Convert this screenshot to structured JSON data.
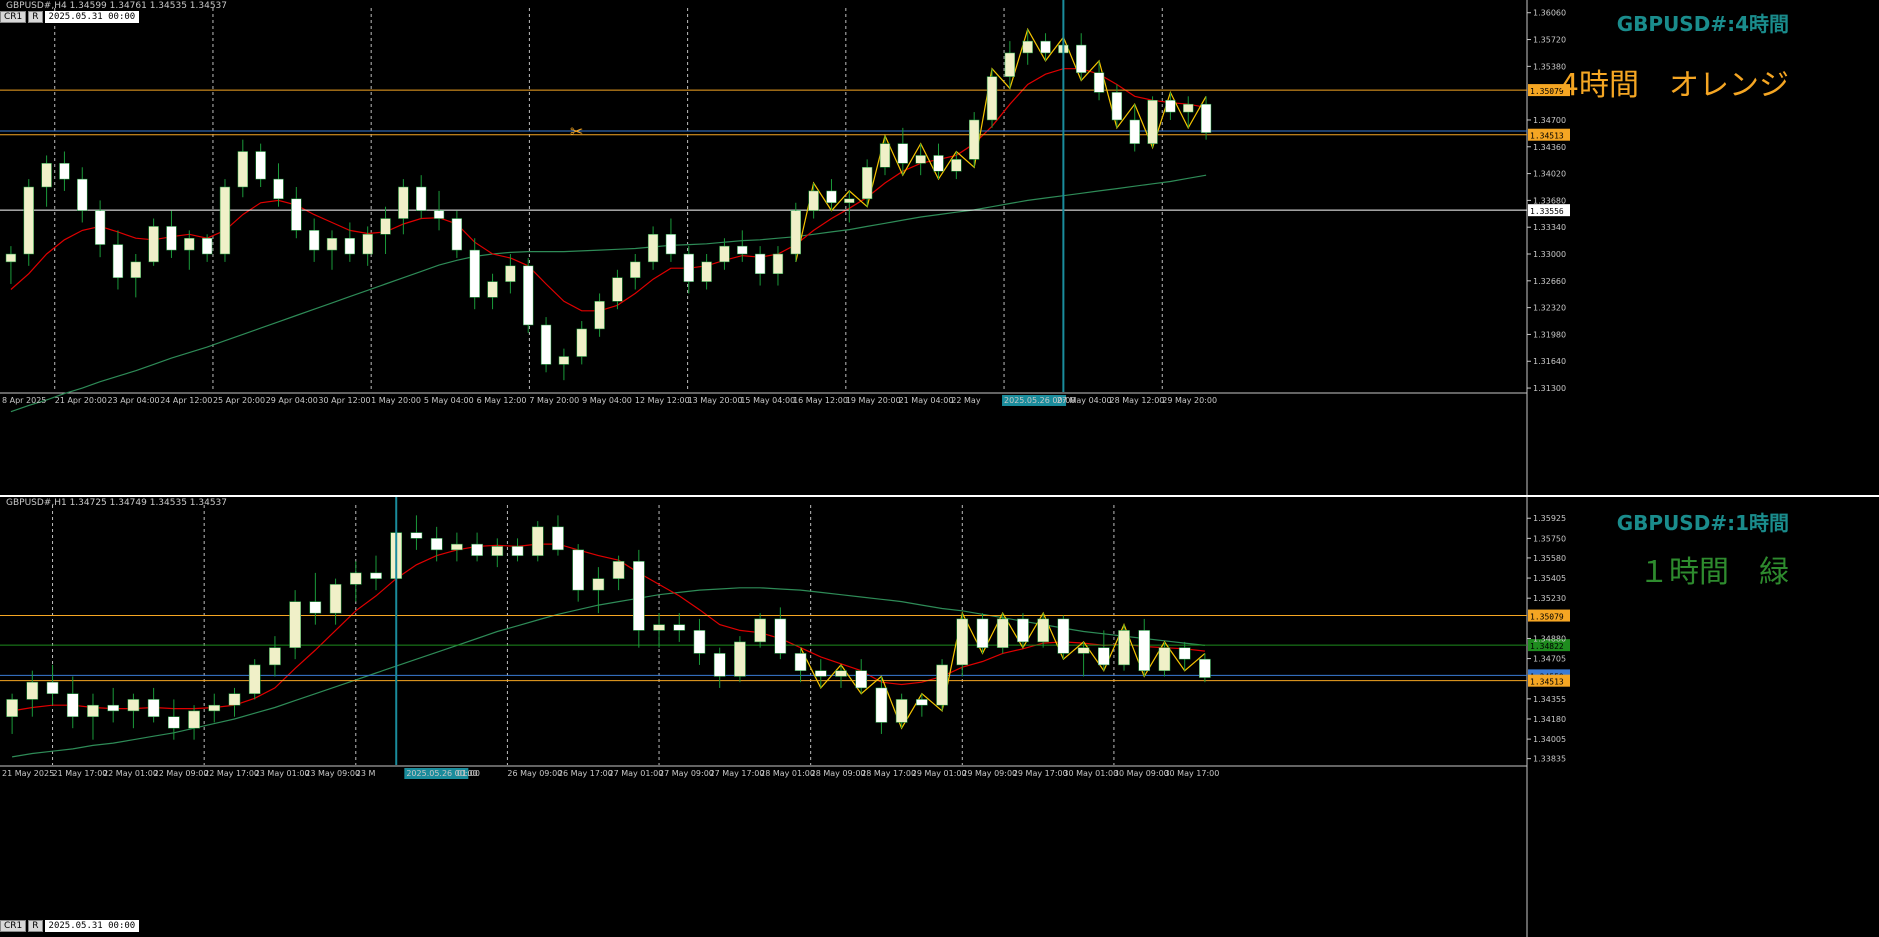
{
  "top": {
    "info": "GBPUSD#,H4 1.34599 1.34761 1.34535 1.34537",
    "buttons": [
      "CR1",
      "R"
    ],
    "datetime": "2025.05.31 00:00",
    "symbol_label": "GBPUSD#:4時間",
    "tag_label": "4時間　オレンジ",
    "tag_color": "#f5a623",
    "marker": "✂",
    "cursor_label": "2025.05.26 00:00"
  },
  "bottom": {
    "info": "GBPUSD#,H1 1.34725 1.34749 1.34535 1.34537",
    "buttons": [
      "CR1",
      "R"
    ],
    "datetime": "2025.05.31 00:00",
    "symbol_label": "GBPUSD#:1時間",
    "tag_label": "１時間　緑",
    "tag_color": "#2e8b2e",
    "cursor_label": "2025.05.26 00:00"
  },
  "colors": {
    "bull": "#f0f0c8",
    "bear": "#ffffff",
    "wick": "#1a9a3a",
    "ma_fast": "#e00000",
    "ma_slow": "#2e8b57",
    "zigzag": "#f5c400",
    "hline_orange": "#f5a623",
    "hline_blue": "#3a7bd5",
    "hline_white": "#ffffff",
    "hline_green": "#1e8c1e",
    "cursor": "#1a8c9c"
  },
  "chart_data": [
    {
      "type": "candlestick",
      "title": "GBPUSD#,H4",
      "x_ticks": [
        "8 Apr 2025",
        "21 Apr 20:00",
        "23 Apr 04:00",
        "24 Apr 12:00",
        "25 Apr 20:00",
        "29 Apr 04:00",
        "30 Apr 12:00",
        "1 May 20:00",
        "5 May 04:00",
        "6 May 12:00",
        "7 May 20:00",
        "9 May 04:00",
        "12 May 12:00",
        "13 May 20:00",
        "15 May 04:00",
        "16 May 12:00",
        "19 May 20:00",
        "21 May 04:00",
        "22 May",
        "2025.05.26 00:00",
        "27 May 04:00",
        "28 May 12:00",
        "29 May 20:00"
      ],
      "y_ticks": [
        "1.36060",
        "1.35720",
        "1.35380",
        "1.34700",
        "1.34360",
        "1.34020",
        "1.33680",
        "1.33340",
        "1.33000",
        "1.32660",
        "1.32320",
        "1.31980",
        "1.31640",
        "1.31300"
      ],
      "ylim": [
        1.3125,
        1.3612
      ],
      "price_labels": [
        "1.35079",
        "1.34513",
        "1.33556"
      ],
      "current_price": 1.34537,
      "ohlc": [
        [
          1.329,
          1.331,
          1.3262,
          1.33
        ],
        [
          1.33,
          1.3395,
          1.3285,
          1.3385
        ],
        [
          1.3385,
          1.3425,
          1.336,
          1.3415
        ],
        [
          1.3415,
          1.343,
          1.338,
          1.3395
        ],
        [
          1.3395,
          1.341,
          1.334,
          1.3355
        ],
        [
          1.3355,
          1.3368,
          1.3296,
          1.3312
        ],
        [
          1.3312,
          1.333,
          1.3255,
          1.327
        ],
        [
          1.327,
          1.33,
          1.3245,
          1.329
        ],
        [
          1.329,
          1.3345,
          1.3285,
          1.3335
        ],
        [
          1.3335,
          1.3355,
          1.3295,
          1.3305
        ],
        [
          1.3305,
          1.333,
          1.328,
          1.332
        ],
        [
          1.332,
          1.3325,
          1.329,
          1.33
        ],
        [
          1.33,
          1.3395,
          1.329,
          1.3385
        ],
        [
          1.3385,
          1.3445,
          1.3372,
          1.343
        ],
        [
          1.343,
          1.344,
          1.3385,
          1.3395
        ],
        [
          1.3395,
          1.3415,
          1.336,
          1.337
        ],
        [
          1.337,
          1.3385,
          1.332,
          1.333
        ],
        [
          1.333,
          1.3345,
          1.329,
          1.3305
        ],
        [
          1.3305,
          1.333,
          1.328,
          1.332
        ],
        [
          1.332,
          1.334,
          1.329,
          1.33
        ],
        [
          1.33,
          1.3335,
          1.3285,
          1.3325
        ],
        [
          1.3325,
          1.336,
          1.33,
          1.3345
        ],
        [
          1.3345,
          1.3395,
          1.3325,
          1.3385
        ],
        [
          1.3385,
          1.34,
          1.3345,
          1.3355
        ],
        [
          1.3355,
          1.338,
          1.333,
          1.3345
        ],
        [
          1.3345,
          1.3355,
          1.3295,
          1.3305
        ],
        [
          1.3305,
          1.332,
          1.323,
          1.3245
        ],
        [
          1.3245,
          1.3275,
          1.323,
          1.3265
        ],
        [
          1.3265,
          1.33,
          1.325,
          1.3285
        ],
        [
          1.3285,
          1.3295,
          1.32,
          1.321
        ],
        [
          1.321,
          1.322,
          1.315,
          1.316
        ],
        [
          1.316,
          1.318,
          1.314,
          1.317
        ],
        [
          1.317,
          1.3215,
          1.316,
          1.3205
        ],
        [
          1.3205,
          1.325,
          1.3195,
          1.324
        ],
        [
          1.324,
          1.328,
          1.323,
          1.327
        ],
        [
          1.327,
          1.33,
          1.3255,
          1.329
        ],
        [
          1.329,
          1.3335,
          1.328,
          1.3325
        ],
        [
          1.3325,
          1.3345,
          1.329,
          1.33
        ],
        [
          1.33,
          1.331,
          1.325,
          1.3265
        ],
        [
          1.3265,
          1.33,
          1.3255,
          1.329
        ],
        [
          1.329,
          1.332,
          1.328,
          1.331
        ],
        [
          1.331,
          1.333,
          1.329,
          1.33
        ],
        [
          1.33,
          1.331,
          1.326,
          1.3275
        ],
        [
          1.3275,
          1.331,
          1.326,
          1.33
        ],
        [
          1.33,
          1.3365,
          1.329,
          1.3355
        ],
        [
          1.3355,
          1.339,
          1.3345,
          1.338
        ],
        [
          1.338,
          1.3395,
          1.3355,
          1.3365
        ],
        [
          1.3365,
          1.338,
          1.334,
          1.337
        ],
        [
          1.337,
          1.342,
          1.336,
          1.341
        ],
        [
          1.341,
          1.345,
          1.34,
          1.344
        ],
        [
          1.344,
          1.346,
          1.34,
          1.3415
        ],
        [
          1.3415,
          1.344,
          1.34,
          1.3425
        ],
        [
          1.3425,
          1.344,
          1.3395,
          1.3405
        ],
        [
          1.3405,
          1.343,
          1.3395,
          1.342
        ],
        [
          1.342,
          1.348,
          1.341,
          1.347
        ],
        [
          1.347,
          1.3535,
          1.346,
          1.3525
        ],
        [
          1.3525,
          1.357,
          1.351,
          1.3555
        ],
        [
          1.3555,
          1.3585,
          1.354,
          1.357
        ],
        [
          1.357,
          1.358,
          1.3545,
          1.3555
        ],
        [
          1.3555,
          1.3575,
          1.354,
          1.3565
        ],
        [
          1.3565,
          1.358,
          1.352,
          1.353
        ],
        [
          1.353,
          1.3545,
          1.3495,
          1.3505
        ],
        [
          1.3505,
          1.3515,
          1.346,
          1.347
        ],
        [
          1.347,
          1.349,
          1.343,
          1.344
        ],
        [
          1.344,
          1.35,
          1.3435,
          1.3495
        ],
        [
          1.3495,
          1.3505,
          1.347,
          1.348
        ],
        [
          1.348,
          1.35,
          1.346,
          1.349
        ],
        [
          1.349,
          1.35,
          1.3445,
          1.3454
        ]
      ],
      "ma_fast": [
        1.3255,
        1.3275,
        1.33,
        1.3318,
        1.333,
        1.3335,
        1.3328,
        1.332,
        1.3318,
        1.3322,
        1.3325,
        1.332,
        1.333,
        1.335,
        1.3365,
        1.3368,
        1.3362,
        1.335,
        1.334,
        1.333,
        1.3326,
        1.3328,
        1.3338,
        1.3345,
        1.3346,
        1.3338,
        1.3315,
        1.33,
        1.3295,
        1.3285,
        1.3262,
        1.324,
        1.3228,
        1.3228,
        1.3235,
        1.325,
        1.3268,
        1.3282,
        1.3282,
        1.3285,
        1.3292,
        1.3298,
        1.3296,
        1.33,
        1.3312,
        1.333,
        1.3345,
        1.3358,
        1.3372,
        1.339,
        1.3405,
        1.3415,
        1.342,
        1.3425,
        1.344,
        1.3462,
        1.349,
        1.3515,
        1.3528,
        1.3535,
        1.3535,
        1.3528,
        1.3515,
        1.35,
        1.3495,
        1.3492,
        1.349,
        1.3486
      ],
      "ma_slow": [
        1.31,
        1.3108,
        1.3115,
        1.3123,
        1.313,
        1.3138,
        1.3145,
        1.3152,
        1.316,
        1.3168,
        1.3175,
        1.3182,
        1.319,
        1.3198,
        1.3206,
        1.3214,
        1.3222,
        1.323,
        1.3238,
        1.3246,
        1.3254,
        1.3262,
        1.327,
        1.3278,
        1.3286,
        1.3292,
        1.3297,
        1.33,
        1.3302,
        1.3303,
        1.3303,
        1.3303,
        1.3304,
        1.3305,
        1.3306,
        1.3307,
        1.3309,
        1.3311,
        1.3312,
        1.3313,
        1.3315,
        1.3317,
        1.3318,
        1.332,
        1.3322,
        1.3325,
        1.3328,
        1.3331,
        1.3335,
        1.3339,
        1.3343,
        1.3347,
        1.335,
        1.3353,
        1.3356,
        1.336,
        1.3364,
        1.3368,
        1.3371,
        1.3374,
        1.3377,
        1.338,
        1.3383,
        1.3386,
        1.3389,
        1.3392,
        1.3396,
        1.34
      ]
    },
    {
      "type": "candlestick",
      "title": "GBPUSD#,H1",
      "x_ticks": [
        "21 May 2025",
        "21 May 17:00",
        "22 May 01:00",
        "22 May 09:00",
        "22 May 17:00",
        "23 May 01:00",
        "23 May 09:00",
        "23 M",
        "2025.05.26 00:00",
        "01:00",
        "26 May 09:00",
        "26 May 17:00",
        "27 May 01:00",
        "27 May 09:00",
        "27 May 17:00",
        "28 May 01:00",
        "28 May 09:00",
        "28 May 17:00",
        "29 May 01:00",
        "29 May 09:00",
        "29 May 17:00",
        "30 May 01:00",
        "30 May 09:00",
        "30 May 17:00"
      ],
      "y_ticks": [
        "1.35925",
        "1.35750",
        "1.35580",
        "1.35405",
        "1.35230",
        "1.34880",
        "1.34705",
        "1.34355",
        "1.34180",
        "1.34005",
        "1.33835"
      ],
      "ylim": [
        1.3378,
        1.3604
      ],
      "price_labels": [
        "1.35079",
        "1.34822",
        "1.34559",
        "1.34513"
      ],
      "current_price": 1.34537,
      "ohlc": [
        [
          1.342,
          1.344,
          1.3405,
          1.3435
        ],
        [
          1.3435,
          1.346,
          1.342,
          1.345
        ],
        [
          1.345,
          1.3465,
          1.343,
          1.344
        ],
        [
          1.344,
          1.3455,
          1.341,
          1.342
        ],
        [
          1.342,
          1.344,
          1.34,
          1.343
        ],
        [
          1.343,
          1.3445,
          1.3415,
          1.3425
        ],
        [
          1.3425,
          1.344,
          1.341,
          1.3435
        ],
        [
          1.3435,
          1.3445,
          1.3415,
          1.342
        ],
        [
          1.342,
          1.3435,
          1.34,
          1.341
        ],
        [
          1.341,
          1.343,
          1.34,
          1.3425
        ],
        [
          1.3425,
          1.344,
          1.3415,
          1.343
        ],
        [
          1.343,
          1.3445,
          1.342,
          1.344
        ],
        [
          1.344,
          1.347,
          1.3435,
          1.3465
        ],
        [
          1.3465,
          1.349,
          1.3455,
          1.348
        ],
        [
          1.348,
          1.353,
          1.347,
          1.352
        ],
        [
          1.352,
          1.3545,
          1.35,
          1.351
        ],
        [
          1.351,
          1.354,
          1.35,
          1.3535
        ],
        [
          1.3535,
          1.3555,
          1.352,
          1.3545
        ],
        [
          1.3545,
          1.356,
          1.353,
          1.354
        ],
        [
          1.354,
          1.359,
          1.3535,
          1.358
        ],
        [
          1.358,
          1.3595,
          1.3565,
          1.3575
        ],
        [
          1.3575,
          1.3585,
          1.3555,
          1.3565
        ],
        [
          1.3565,
          1.358,
          1.3555,
          1.357
        ],
        [
          1.357,
          1.358,
          1.3555,
          1.356
        ],
        [
          1.356,
          1.3575,
          1.355,
          1.3568
        ],
        [
          1.3568,
          1.3575,
          1.3555,
          1.356
        ],
        [
          1.356,
          1.359,
          1.3555,
          1.3585
        ],
        [
          1.3585,
          1.3595,
          1.356,
          1.3565
        ],
        [
          1.3565,
          1.357,
          1.352,
          1.353
        ],
        [
          1.353,
          1.355,
          1.351,
          1.354
        ],
        [
          1.354,
          1.356,
          1.353,
          1.3555
        ],
        [
          1.3555,
          1.3565,
          1.348,
          1.3495
        ],
        [
          1.3495,
          1.351,
          1.348,
          1.35
        ],
        [
          1.35,
          1.351,
          1.3485,
          1.3495
        ],
        [
          1.3495,
          1.3505,
          1.3465,
          1.3475
        ],
        [
          1.3475,
          1.348,
          1.3445,
          1.3455
        ],
        [
          1.3455,
          1.349,
          1.345,
          1.3485
        ],
        [
          1.3485,
          1.351,
          1.348,
          1.3505
        ],
        [
          1.3505,
          1.3515,
          1.347,
          1.3475
        ],
        [
          1.3475,
          1.348,
          1.345,
          1.346
        ],
        [
          1.346,
          1.347,
          1.3445,
          1.3455
        ],
        [
          1.3455,
          1.3465,
          1.3445,
          1.346
        ],
        [
          1.346,
          1.347,
          1.344,
          1.3445
        ],
        [
          1.3445,
          1.3455,
          1.3405,
          1.3415
        ],
        [
          1.3415,
          1.344,
          1.341,
          1.3435
        ],
        [
          1.3435,
          1.344,
          1.342,
          1.343
        ],
        [
          1.343,
          1.347,
          1.3425,
          1.3465
        ],
        [
          1.3465,
          1.351,
          1.3455,
          1.3505
        ],
        [
          1.3505,
          1.351,
          1.3475,
          1.348
        ],
        [
          1.348,
          1.351,
          1.3475,
          1.3505
        ],
        [
          1.3505,
          1.351,
          1.348,
          1.3485
        ],
        [
          1.3485,
          1.351,
          1.348,
          1.3505
        ],
        [
          1.3505,
          1.3508,
          1.347,
          1.3475
        ],
        [
          1.3475,
          1.3485,
          1.3455,
          1.348
        ],
        [
          1.348,
          1.3495,
          1.346,
          1.3465
        ],
        [
          1.3465,
          1.35,
          1.346,
          1.3495
        ],
        [
          1.3495,
          1.3505,
          1.3455,
          1.346
        ],
        [
          1.346,
          1.3485,
          1.3455,
          1.348
        ],
        [
          1.348,
          1.3485,
          1.346,
          1.347
        ],
        [
          1.347,
          1.3475,
          1.345,
          1.3454
        ]
      ],
      "ma_fast": [
        1.3425,
        1.3428,
        1.343,
        1.343,
        1.3428,
        1.3427,
        1.3427,
        1.3428,
        1.3427,
        1.3427,
        1.3428,
        1.343,
        1.3436,
        1.3445,
        1.3462,
        1.3478,
        1.3495,
        1.3512,
        1.3525,
        1.354,
        1.3552,
        1.356,
        1.3565,
        1.3568,
        1.3569,
        1.3568,
        1.357,
        1.357,
        1.3565,
        1.356,
        1.3556,
        1.3545,
        1.3535,
        1.3525,
        1.3513,
        1.35,
        1.3495,
        1.3493,
        1.3488,
        1.348,
        1.3472,
        1.3466,
        1.346,
        1.345,
        1.3448,
        1.345,
        1.3455,
        1.3463,
        1.3468,
        1.3475,
        1.3479,
        1.3484,
        1.3485,
        1.3484,
        1.3482,
        1.3483,
        1.3481,
        1.348,
        1.3479,
        1.3477
      ],
      "ma_slow": [
        1.3385,
        1.3388,
        1.339,
        1.3392,
        1.3395,
        1.3397,
        1.34,
        1.3403,
        1.3406,
        1.341,
        1.3414,
        1.3418,
        1.3423,
        1.3428,
        1.3434,
        1.344,
        1.3446,
        1.3452,
        1.3458,
        1.3464,
        1.347,
        1.3476,
        1.3482,
        1.3488,
        1.3494,
        1.3499,
        1.3504,
        1.3509,
        1.3513,
        1.3517,
        1.352,
        1.3523,
        1.3526,
        1.3528,
        1.353,
        1.3531,
        1.3532,
        1.3532,
        1.3531,
        1.353,
        1.3528,
        1.3526,
        1.3524,
        1.3522,
        1.352,
        1.3517,
        1.3514,
        1.3512,
        1.3509,
        1.3506,
        1.3503,
        1.35,
        1.3497,
        1.3494,
        1.3492,
        1.349,
        1.3488,
        1.3486,
        1.3484,
        1.3482
      ]
    }
  ],
  "hlines": {
    "top": [
      {
        "price": 1.35079,
        "color": "#f5a623",
        "label": "1.35079"
      },
      {
        "price": 1.3456,
        "color": "#3a7bd5",
        "label": ""
      },
      {
        "price": 1.34513,
        "color": "#f5a623",
        "label": "1.34513"
      },
      {
        "price": 1.33556,
        "color": "#ffffff",
        "label": "1.33556"
      }
    ],
    "bottom": [
      {
        "price": 1.35079,
        "color": "#f5a623",
        "label": "1.35079"
      },
      {
        "price": 1.34822,
        "color": "#1e8c1e",
        "label": "1.34822"
      },
      {
        "price": 1.34559,
        "color": "#3a7bd5",
        "label": "1.34559"
      },
      {
        "price": 1.34513,
        "color": "#f5a623",
        "label": "1.34513"
      }
    ]
  }
}
